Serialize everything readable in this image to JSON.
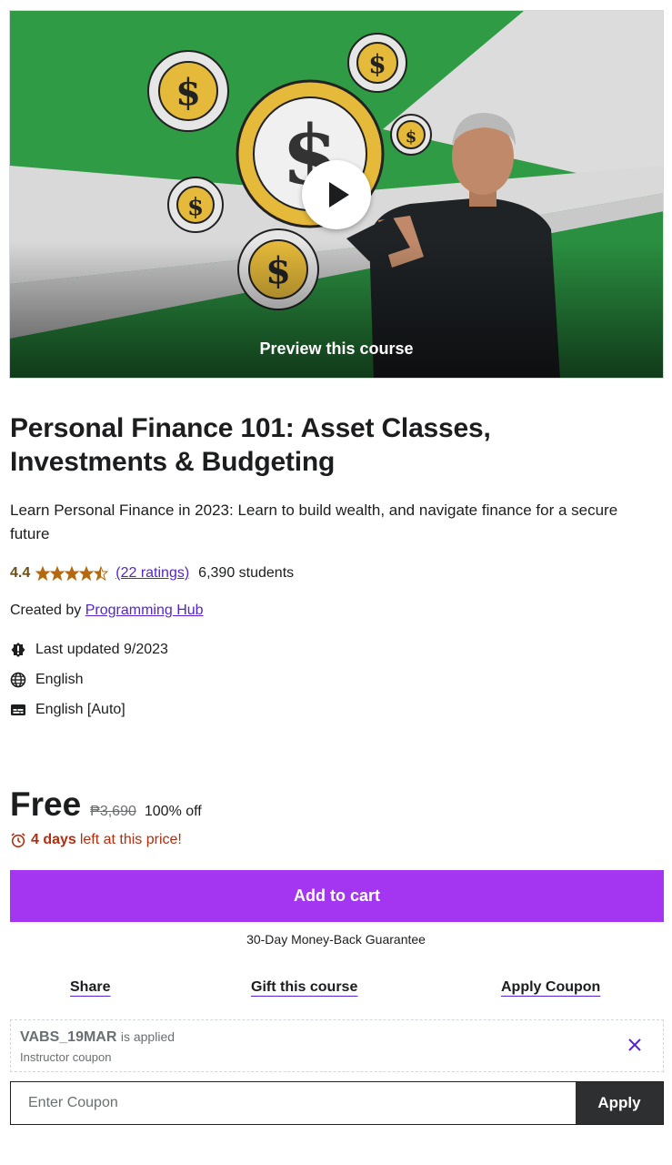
{
  "preview": {
    "label": "Preview this course",
    "image_icon": "course-thumbnail",
    "play_icon": "play-icon"
  },
  "course": {
    "title": "Personal Finance 101: Asset Classes, Investments & Budgeting",
    "subtitle": "Learn Personal Finance in 2023: Learn to build wealth, and navigate finance for a secure future",
    "rating": "4.4",
    "stars_value": 4.4,
    "ratings_count": "(22 ratings)",
    "students": "6,390 students",
    "created_by_label": "Created by",
    "instructor": "Programming Hub",
    "last_updated": "Last updated 9/2023",
    "language": "English",
    "captions": "English [Auto]"
  },
  "pricing": {
    "current": "Free",
    "original": "₱3,690",
    "discount": "100% off",
    "countdown_bold": "4 days",
    "countdown_rest": "left at this price!"
  },
  "actions": {
    "add_to_cart": "Add to cart",
    "guarantee": "30-Day Money-Back Guarantee",
    "share": "Share",
    "gift": "Gift this course",
    "apply_coupon": "Apply Coupon"
  },
  "coupon": {
    "code": "VABS_19MAR",
    "applied_text": "is applied",
    "type": "Instructor coupon",
    "input_placeholder": "Enter Coupon",
    "input_value": "",
    "apply_label": "Apply"
  },
  "colors": {
    "brand_purple": "#a435f0",
    "link_purple": "#5624d0",
    "star_orange": "#b4690e",
    "alert_red": "#b32d0f",
    "dark": "#2d2f31",
    "thumb_green": "#2f9b45"
  }
}
